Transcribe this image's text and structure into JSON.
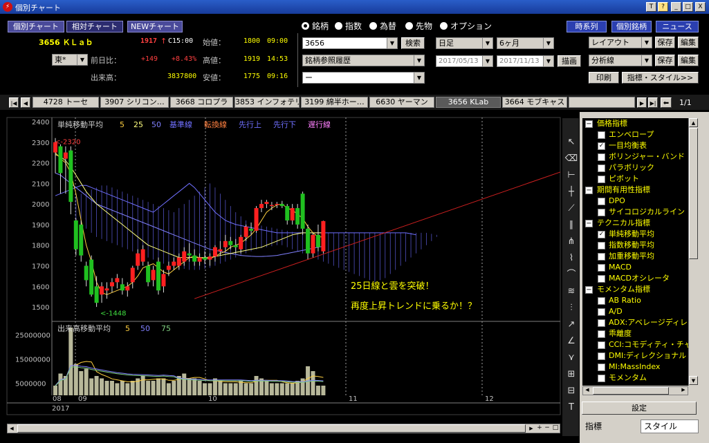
{
  "window": {
    "title": "個別チャート",
    "controls": [
      "T",
      "?",
      "_",
      "□",
      "X"
    ]
  },
  "top_tabs": [
    {
      "label": "個別チャート",
      "selected": false
    },
    {
      "label": "相対チャート",
      "selected": true
    },
    {
      "label": "NEWチャート",
      "selected": false
    }
  ],
  "quote": {
    "code_name": "3656 ＫＬａｂ",
    "price": "1917",
    "arrow": "↑",
    "time": "C15:00",
    "market": "東*",
    "prev_diff_label": "前日比：",
    "prev_diff": "+149",
    "prev_diff_pct": "+8.43%",
    "volume_label": "出来高：",
    "volume": "3837800",
    "open_label": "始値：",
    "open": "1800",
    "open_time": "09:00",
    "high_label": "高値：",
    "high": "1919",
    "high_time": "14:53",
    "low_label": "安値：",
    "low": "1775",
    "low_time": "09:16"
  },
  "asset_radios": [
    {
      "label": "銘柄",
      "selected": true
    },
    {
      "label": "指数",
      "selected": false
    },
    {
      "label": "為替",
      "selected": false
    },
    {
      "label": "先物",
      "selected": false
    },
    {
      "label": "オプション",
      "selected": false
    }
  ],
  "symbol_input": "3656",
  "search_label": "検索",
  "history_combo": "銘柄参照履歴",
  "blank_combo": "ー",
  "period_combo": "日足",
  "range_combo": "6ヶ月",
  "date_from": "2017/05/13",
  "date_to": "2017/11/13",
  "draw_label": "描画",
  "right_buttons": [
    "時系列",
    "個別銘柄",
    "ニュース"
  ],
  "layout_combo": "レイアウト",
  "analysis_combo": "分析線",
  "save_label": "保存",
  "edit_label": "編集",
  "print_label": "印刷",
  "indicator_style_label": "指標・スタイル>>",
  "symbol_tabs": [
    {
      "label": "4728 トーセ",
      "active": false
    },
    {
      "label": "3907 シリコン…",
      "active": false
    },
    {
      "label": "3668 コロプラ",
      "active": false
    },
    {
      "label": "3853 インフォテリ",
      "active": false
    },
    {
      "label": "3199 綿半ホー…",
      "active": false
    },
    {
      "label": "6630 ヤーマン",
      "active": false
    },
    {
      "label": "3656 KLab",
      "active": true
    },
    {
      "label": "3664 モブキャス",
      "active": false
    }
  ],
  "page_indicator": "1/1",
  "chart_data": {
    "type": "candlestick",
    "price_legend": [
      {
        "text": "単純移動平均",
        "color": "#d0d0d0"
      },
      {
        "text": "5",
        "color": "#ffd040"
      },
      {
        "text": "25",
        "color": "#ffff80"
      },
      {
        "text": "50",
        "color": "#8080ff"
      },
      {
        "text": "基準線",
        "color": "#7070ff"
      },
      {
        "text": "転換線",
        "color": "#ff8040"
      },
      {
        "text": "先行上",
        "color": "#7070ff"
      },
      {
        "text": "先行下",
        "color": "#7070ff"
      },
      {
        "text": "遅行線",
        "color": "#ff80ff"
      }
    ],
    "volume_legend": [
      {
        "text": "出来高移動平均",
        "color": "#d0d0d0"
      },
      {
        "text": "5",
        "color": "#ffd040"
      },
      {
        "text": "50",
        "color": "#8080ff"
      },
      {
        "text": "75",
        "color": "#80d080"
      }
    ],
    "y_ticks": [
      2400,
      2300,
      2200,
      2100,
      2000,
      1900,
      1800,
      1700,
      1600,
      1500
    ],
    "ylim": [
      1440,
      2420
    ],
    "volume_ticks": [
      "25000000",
      "15000000",
      "5000000"
    ],
    "volume_ylim": [
      0,
      30000000
    ],
    "x_months": [
      "08",
      "09",
      "10",
      "11",
      "12"
    ],
    "year": "2017",
    "high_marker": "<-2320",
    "low_marker": "<-1448",
    "annotation_lines": [
      "25日線と雲を突破！",
      "再度上昇トレンドに乗るか！？"
    ],
    "candles": [
      [
        2250,
        2320,
        2150,
        2300
      ],
      [
        2280,
        2290,
        2050,
        2150
      ],
      [
        2220,
        2280,
        2050,
        2250
      ],
      [
        2260,
        2280,
        1950,
        2010
      ],
      [
        1920,
        1930,
        1750,
        1780
      ],
      [
        1900,
        1920,
        1720,
        1750
      ],
      [
        1700,
        1720,
        1600,
        1630
      ],
      [
        1730,
        1750,
        1550,
        1560
      ],
      [
        1600,
        1650,
        1500,
        1520
      ],
      [
        1560,
        1620,
        1520,
        1600
      ],
      [
        1580,
        1620,
        1540,
        1590
      ],
      [
        1600,
        1640,
        1570,
        1620
      ],
      [
        1620,
        1660,
        1590,
        1640
      ],
      [
        1610,
        1640,
        1560,
        1580
      ],
      [
        1580,
        1620,
        1550,
        1600
      ],
      [
        1620,
        1700,
        1590,
        1690
      ],
      [
        1700,
        1780,
        1680,
        1760
      ],
      [
        1720,
        1800,
        1700,
        1780
      ],
      [
        1700,
        1720,
        1600,
        1620
      ],
      [
        1630,
        1700,
        1600,
        1680
      ],
      [
        1720,
        1740,
        1560,
        1580
      ],
      [
        1600,
        1680,
        1570,
        1660
      ],
      [
        1680,
        1720,
        1650,
        1700
      ],
      [
        1700,
        1740,
        1680,
        1720
      ],
      [
        1700,
        1760,
        1680,
        1740
      ],
      [
        1720,
        1790,
        1700,
        1770
      ],
      [
        1760,
        1810,
        1720,
        1750
      ],
      [
        1750,
        1780,
        1700,
        1720
      ],
      [
        1720,
        1760,
        1700,
        1740
      ],
      [
        1740,
        1770,
        1710,
        1730
      ],
      [
        1730,
        1760,
        1700,
        1745
      ],
      [
        1745,
        1800,
        1720,
        1790
      ],
      [
        1770,
        1820,
        1750,
        1780
      ],
      [
        1790,
        1850,
        1770,
        1820
      ],
      [
        1820,
        1840,
        1780,
        1800
      ],
      [
        1800,
        1830,
        1760,
        1790
      ],
      [
        1780,
        1850,
        1760,
        1840
      ],
      [
        1840,
        1900,
        1820,
        1890
      ],
      [
        1880,
        1910,
        1850,
        1870
      ],
      [
        1870,
        1990,
        1860,
        1980
      ],
      [
        1980,
        2020,
        1960,
        2000
      ],
      [
        2000,
        2020,
        1980,
        2010
      ],
      [
        1990,
        2010,
        1970,
        1995
      ],
      [
        1995,
        2010,
        1980,
        2000
      ],
      [
        2000,
        2015,
        1980,
        1990
      ],
      [
        1990,
        2000,
        1900,
        1920
      ],
      [
        1920,
        2000,
        1900,
        1980
      ],
      [
        1980,
        2000,
        1880,
        1900
      ],
      [
        2050,
        2060,
        1850,
        1880
      ],
      [
        1880,
        1900,
        1730,
        1760
      ],
      [
        1760,
        1860,
        1740,
        1850
      ],
      [
        1850,
        1900,
        1770,
        1790
      ],
      [
        1770,
        1919,
        1760,
        1917
      ]
    ],
    "volumes": [
      4,
      9,
      8,
      28,
      13,
      10,
      11,
      7,
      8,
      7,
      6,
      6,
      5,
      6,
      5,
      6,
      7,
      8,
      6,
      6,
      7,
      7,
      5,
      6,
      8,
      9,
      7,
      7,
      6,
      5,
      5,
      7,
      6,
      5,
      5,
      5,
      6,
      5,
      5,
      8,
      7,
      6,
      5,
      5,
      5,
      5,
      5,
      6,
      7,
      12,
      10,
      4,
      4
    ],
    "ma5": [
      2250,
      2220,
      2200,
      2150,
      2050,
      1920,
      1800,
      1720,
      1620,
      1570,
      1560,
      1570,
      1580,
      1590,
      1600,
      1620,
      1650,
      1690,
      1700,
      1710,
      1690,
      1670,
      1660,
      1680,
      1700,
      1720,
      1740,
      1745,
      1740,
      1735,
      1735,
      1745,
      1760,
      1770,
      1790,
      1800,
      1810,
      1830,
      1850,
      1880,
      1920,
      1960,
      1980,
      1995,
      2000,
      1980,
      1970,
      1950,
      1930,
      1890,
      1860,
      1840,
      1840
    ],
    "ma25": [
      2240,
      2230,
      2210,
      2180,
      2140,
      2100,
      2060,
      2030,
      2000,
      1980,
      1960,
      1940,
      1920,
      1900,
      1880,
      1860,
      1840,
      1820,
      1800,
      1790,
      1780,
      1770,
      1760,
      1750,
      1740,
      1740,
      1740,
      1740,
      1740,
      1740,
      1740,
      1745,
      1750,
      1755,
      1760,
      1765,
      1770,
      1775,
      1780,
      1785,
      1790,
      1800,
      1810,
      1820,
      1830,
      1840,
      1850,
      1855,
      1860,
      1860,
      1860,
      1860,
      1860
    ],
    "ma50": [
      2150,
      2140,
      2120,
      2100,
      2080,
      2060,
      2040,
      2020,
      2000,
      1990,
      1980,
      1970,
      1960,
      1950,
      1940,
      1930,
      1920,
      1910,
      1900,
      1890,
      1880,
      1870,
      1860,
      1850,
      1840,
      1830,
      1820,
      1810,
      1800,
      1790,
      1780,
      1775,
      1770,
      1765,
      1760,
      1755,
      1750,
      1748,
      1746,
      1745,
      1745,
      1746,
      1748,
      1750,
      1755,
      1760,
      1765,
      1770,
      1775,
      1780,
      1785,
      1790,
      1795
    ],
    "cloud_top": [
      2040,
      2050,
      2060,
      2070,
      2080,
      2090,
      2090,
      2080,
      2070,
      2060,
      2050,
      2040,
      2030,
      2020,
      2010,
      2000,
      1990,
      1980,
      1970,
      1960,
      1980,
      2000,
      2020,
      2040,
      2060,
      2080,
      2100,
      2080,
      2050,
      2020,
      1990,
      1960,
      1940,
      1920,
      1910,
      1900,
      1895,
      1890,
      1885,
      1880,
      1875,
      1870,
      1865,
      1860,
      1860,
      1860,
      1860,
      1860,
      1860,
      1860,
      1860,
      1860,
      1860,
      1860,
      1860,
      1860,
      1860,
      1860,
      1860,
      1860,
      1860,
      1860,
      1860,
      1860,
      1860,
      1860,
      1860,
      1860,
      1860,
      1855,
      1850
    ],
    "cloud_bottom": [
      1920,
      1900,
      1880,
      1860,
      1840,
      1830,
      1820,
      1810,
      1800,
      1790,
      1780,
      1770,
      1760,
      1750,
      1740,
      1730,
      1720,
      1710,
      1700,
      1695,
      1690,
      1685,
      1680,
      1680,
      1680,
      1685,
      1690,
      1700,
      1710,
      1720,
      1730,
      1740,
      1750,
      1760,
      1770,
      1780,
      1785,
      1790,
      1795,
      1800,
      1800,
      1790,
      1780,
      1770,
      1760,
      1750,
      1740,
      1730,
      1720,
      1710,
      1700,
      1690,
      1680,
      1670,
      1660,
      1650,
      1640,
      1630,
      1620,
      1630,
      1640,
      1660,
      1680,
      1700,
      1720,
      1740,
      1760,
      1780,
      1800,
      1820,
      1840
    ]
  },
  "indicator_tree": [
    {
      "type": "group",
      "label": "価格指標"
    },
    {
      "type": "item",
      "label": "エンベロープ",
      "checked": false
    },
    {
      "type": "item",
      "label": "一目均衡表",
      "checked": true
    },
    {
      "type": "item",
      "label": "ボリンジャー・バンド",
      "checked": false
    },
    {
      "type": "item",
      "label": "パラボリック",
      "checked": false
    },
    {
      "type": "item",
      "label": "ピボット",
      "checked": false
    },
    {
      "type": "group",
      "label": "期間有用性指標"
    },
    {
      "type": "item",
      "label": "DPO",
      "checked": false
    },
    {
      "type": "item",
      "label": "サイコロジカルライン",
      "checked": false
    },
    {
      "type": "group",
      "label": "テクニカル指標"
    },
    {
      "type": "item",
      "label": "単純移動平均",
      "checked": true
    },
    {
      "type": "item",
      "label": "指数移動平均",
      "checked": false
    },
    {
      "type": "item",
      "label": "加重移動平均",
      "checked": false
    },
    {
      "type": "item",
      "label": "MACD",
      "checked": false
    },
    {
      "type": "item",
      "label": "MACDオシレータ",
      "checked": false
    },
    {
      "type": "group",
      "label": "モメンタム指標"
    },
    {
      "type": "item",
      "label": "AB Ratio",
      "checked": false
    },
    {
      "type": "item",
      "label": "A/D",
      "checked": false
    },
    {
      "type": "item",
      "label": "ADX:アベレージディレ",
      "checked": false
    },
    {
      "type": "item",
      "label": "乖離度",
      "checked": false
    },
    {
      "type": "item",
      "label": "CCI:コモディティ・チャ",
      "checked": false
    },
    {
      "type": "item",
      "label": "DMI:ディレクショナル",
      "checked": false
    },
    {
      "type": "item",
      "label": "MI:MassIndex",
      "checked": false
    },
    {
      "type": "item",
      "label": "モメンタム",
      "checked": false
    }
  ],
  "settings_label": "設定",
  "bottom_tabs": [
    {
      "label": "指標",
      "active": true
    },
    {
      "label": "スタイル",
      "active": false
    }
  ],
  "colors": {
    "up": "#ff2020",
    "down": "#20c020",
    "label_yellow": "#ffff00"
  }
}
